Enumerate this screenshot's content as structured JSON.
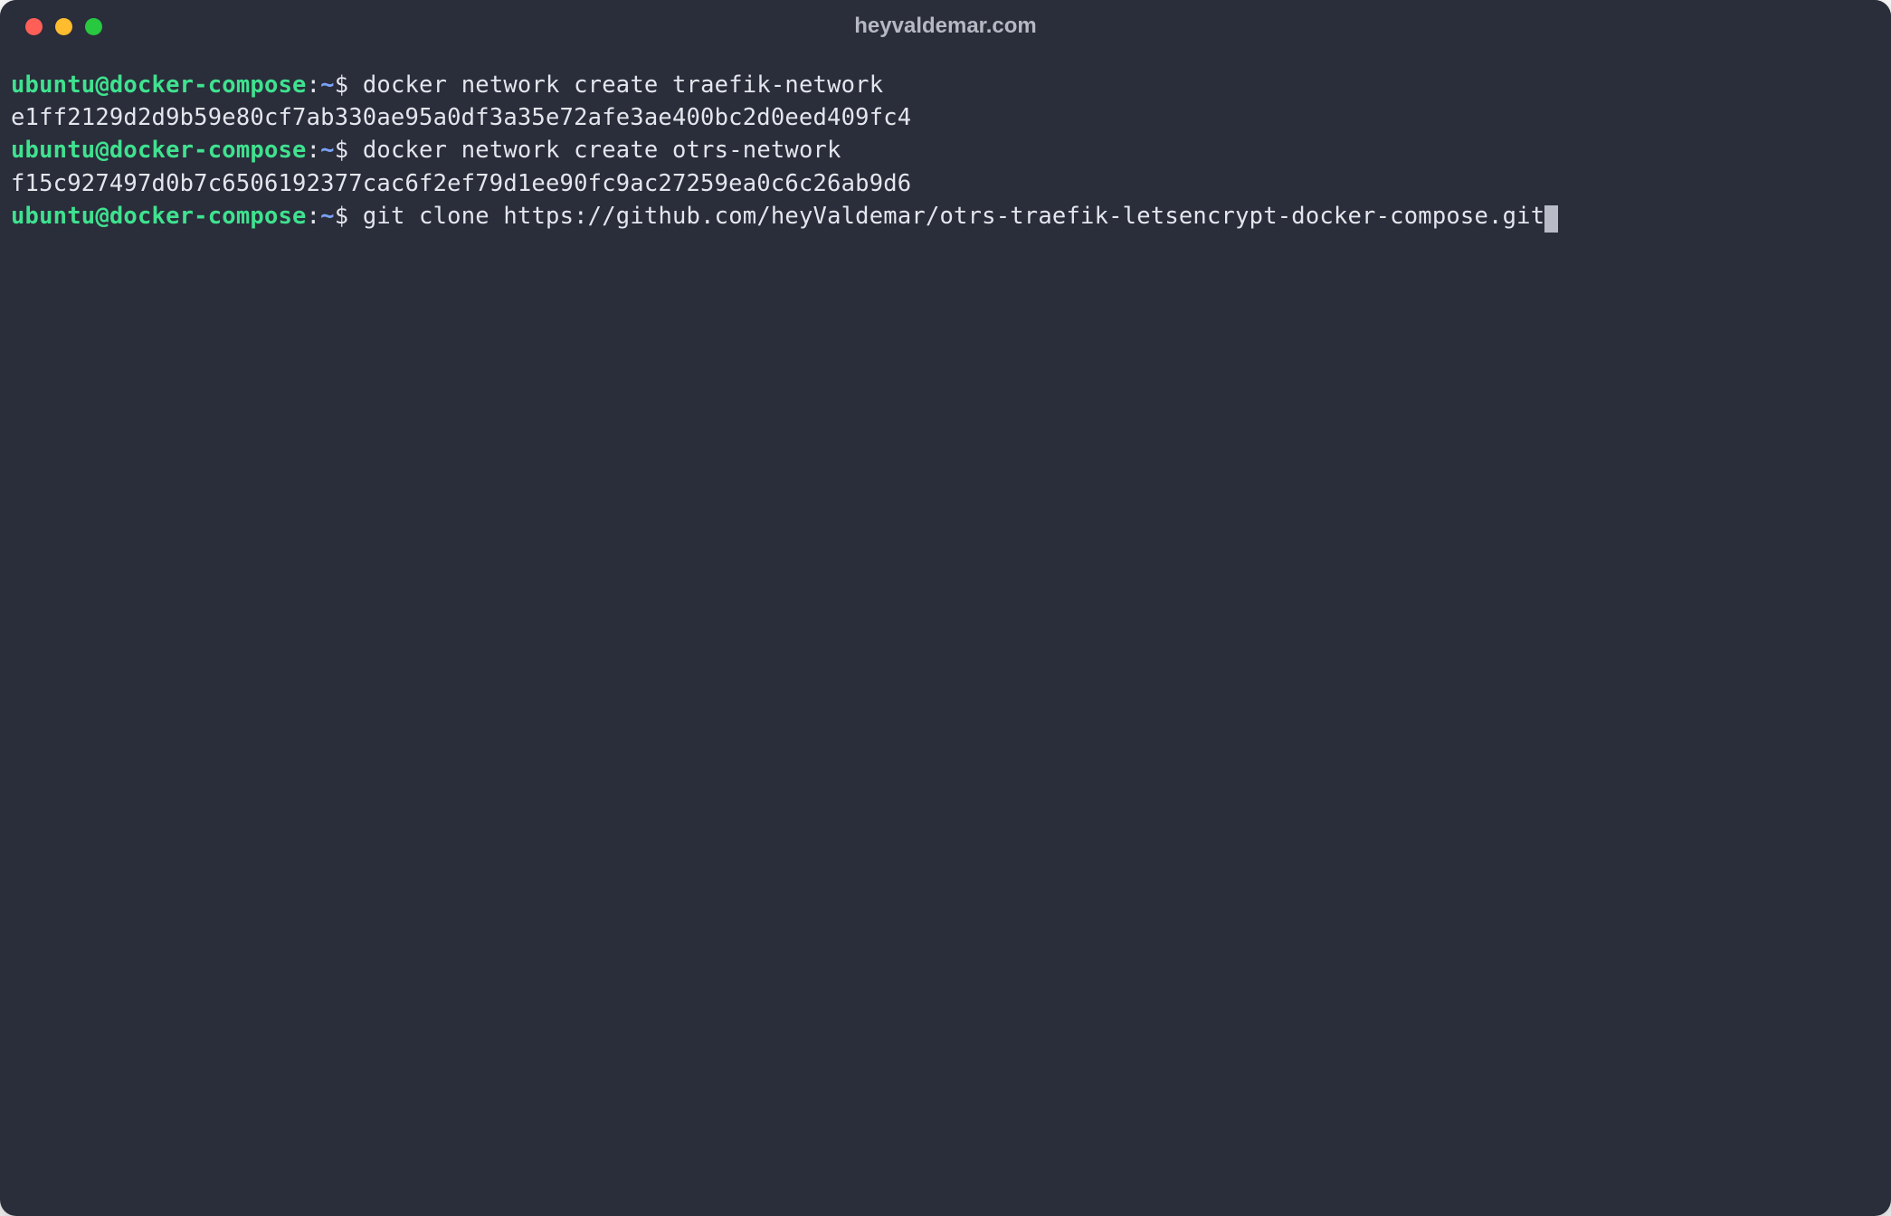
{
  "window": {
    "title": "heyvaldemar.com"
  },
  "prompt": {
    "user_host": "ubuntu@docker-compose",
    "separator": ":",
    "path": "~",
    "symbol": "$"
  },
  "lines": {
    "cmd1": " docker network create traefik-network",
    "out1": "e1ff2129d2d9b59e80cf7ab330ae95a0df3a35e72afe3ae400bc2d0eed409fc4",
    "cmd2": " docker network create otrs-network",
    "out2": "f15c927497d0b7c6506192377cac6f2ef79d1ee90fc9ac27259ea0c6c26ab9d6",
    "cmd3": " git clone https://github.com/heyValdemar/otrs-traefik-letsencrypt-docker-compose.git"
  },
  "colors": {
    "bg": "#2a2d3a",
    "prompt_green": "#3fe28f",
    "path_blue": "#7aa2f7",
    "text": "#e4e6ed"
  }
}
